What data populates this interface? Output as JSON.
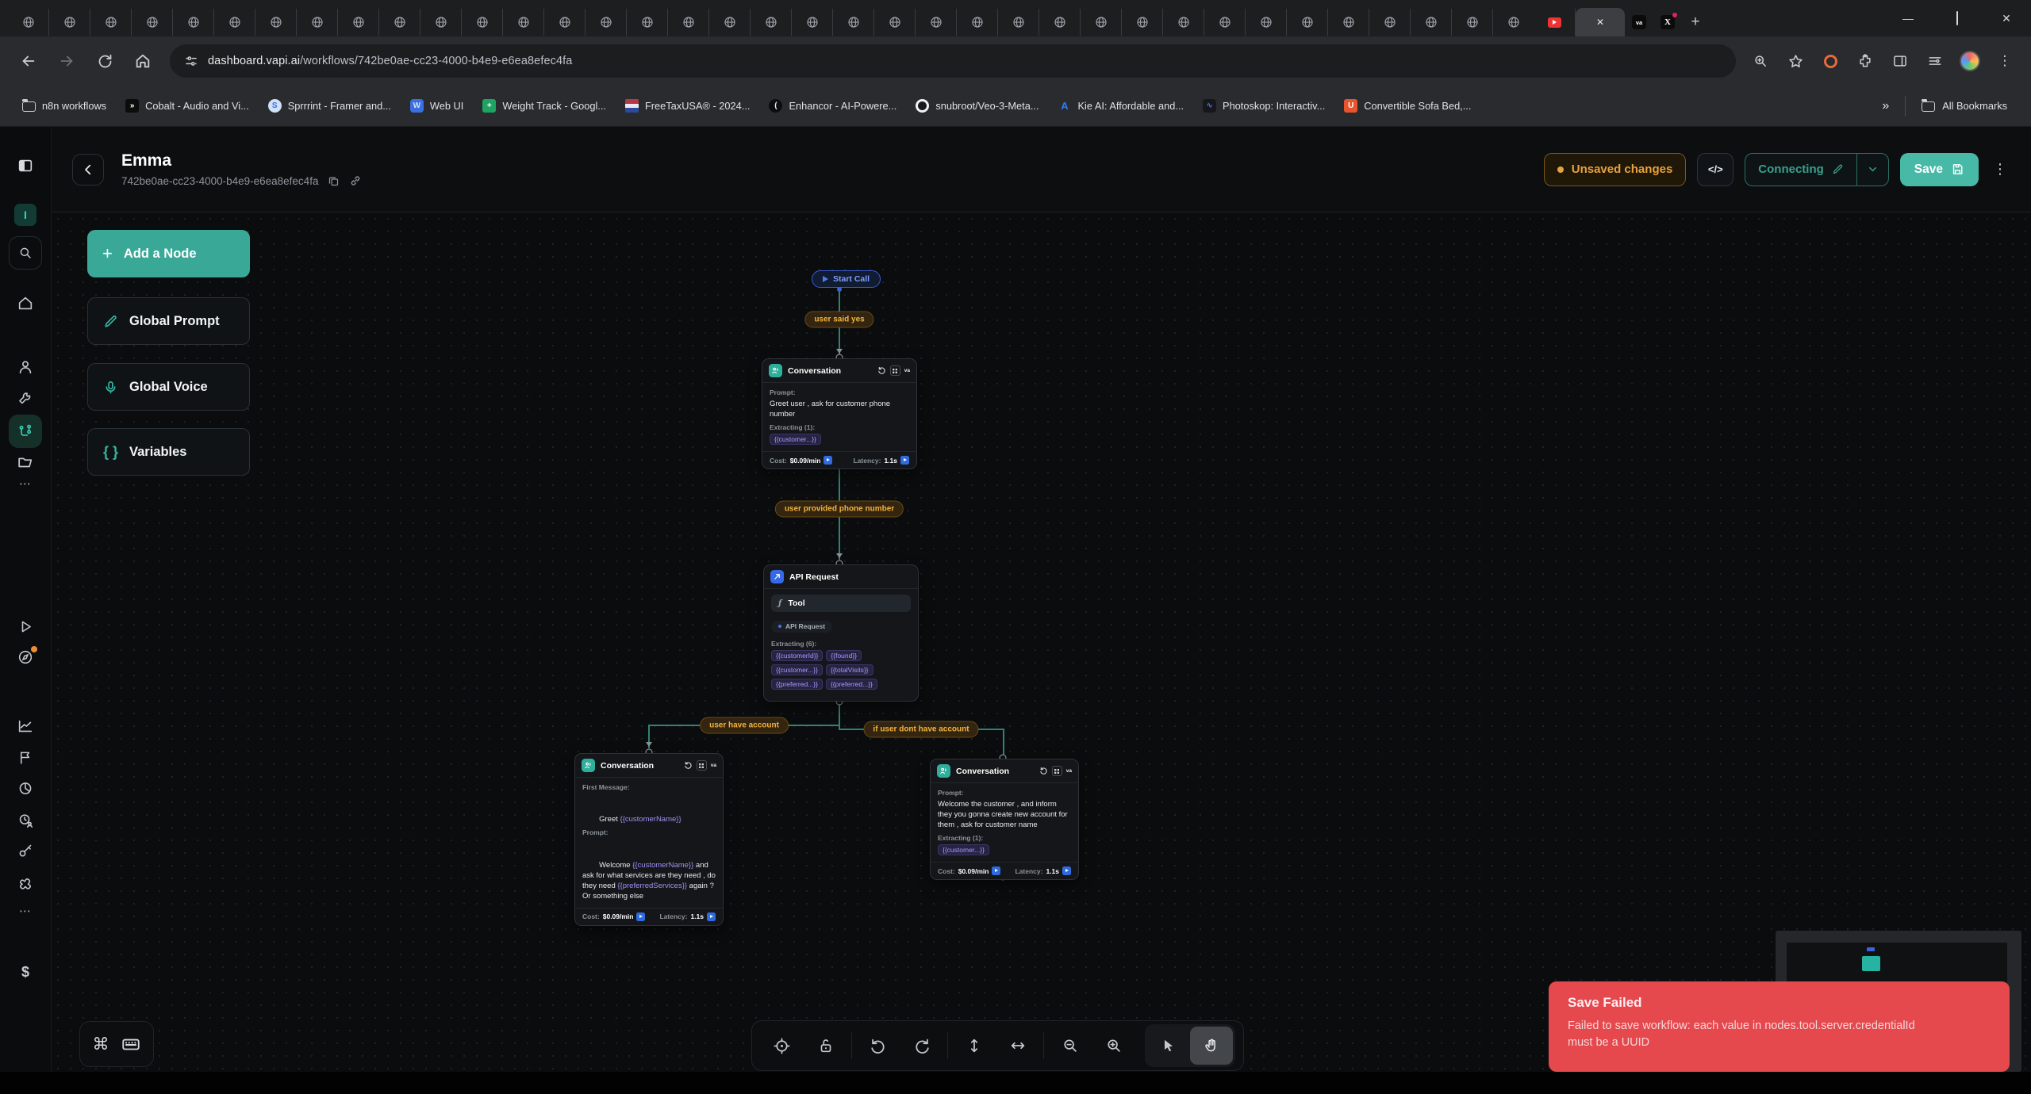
{
  "colors": {
    "accent_teal": "#39a897",
    "save_teal": "#48b9a6",
    "warning_amber": "#e9a33c",
    "error_red": "#e5484d",
    "variable_purple": "#a190f5",
    "edge_teal": "#2e8471",
    "start_blue": "#7e9dfc"
  },
  "browser": {
    "generic_tab_count": 37,
    "active_tab_close": "✕",
    "va_tab_label": "va",
    "x_tab_label": "X",
    "new_tab_glyph": "+",
    "window_controls": {
      "minimize": "—",
      "close": "✕"
    },
    "url_host": "dashboard.vapi.ai",
    "url_path": "/workflows/742be0ae-cc23-4000-b4e9-e6ea8efec4fa",
    "bookmarks": [
      {
        "label": "n8n workflows",
        "icon": "folder"
      },
      {
        "label": "Cobalt - Audio and Vi...",
        "icon": "cobalt",
        "glyph": "»"
      },
      {
        "label": "Sprrrint - Framer and...",
        "icon": "sprrrint",
        "glyph": "S"
      },
      {
        "label": "Web UI",
        "icon": "webui",
        "glyph": "W"
      },
      {
        "label": "Weight Track - Googl...",
        "icon": "sheets",
        "glyph": "+"
      },
      {
        "label": "FreeTaxUSA® - 2024...",
        "icon": "freetax",
        "glyph": ""
      },
      {
        "label": "Enhancor - AI-Powere...",
        "icon": "enhancor",
        "glyph": "("
      },
      {
        "label": "snubroot/Veo-3-Meta...",
        "icon": "github",
        "glyph": ""
      },
      {
        "label": "Kie AI: Affordable and...",
        "icon": "kie",
        "glyph": "A"
      },
      {
        "label": "Photoskop: Interactiv...",
        "icon": "photoskop",
        "glyph": "∿"
      },
      {
        "label": "Convertible Sofa Bed,...",
        "icon": "sofa",
        "glyph": "U"
      }
    ],
    "overflow_glyph": "»",
    "all_bookmarks_label": "All Bookmarks",
    "urlbar_right_icons": [
      "zoom-search-icon",
      "star-icon",
      "extension-alert-icon",
      "puzzle-icon",
      "side-panel-icon",
      "tune-icon",
      "avatar",
      "menu-kebab-icon"
    ]
  },
  "sidebar": {
    "org_initial": "I",
    "billing_glyph": "$",
    "more_glyph": "⋯",
    "icons": [
      "panel-toggle-icon",
      "org-badge",
      "search-icon",
      "home-icon",
      "assistants-icon",
      "tools-icon",
      "workflows-icon",
      "files-icon",
      "more-icon",
      "test-icon",
      "discover-icon",
      "analytics-icon",
      "flags-icon",
      "usage-icon",
      "sessions-icon",
      "keys-icon",
      "integrations-icon",
      "more-icon",
      "billing-icon"
    ]
  },
  "header": {
    "title": "Emma",
    "workflow_id": "742be0ae-cc23-4000-b4e9-e6ea8efec4fa",
    "unsaved_badge": "Unsaved changes",
    "code_button": "</>",
    "connecting_button": "Connecting",
    "save_button": "Save",
    "kebab_glyph": "⋮"
  },
  "panel": {
    "add_node": "Add a Node",
    "add_glyph": "+",
    "global_prompt": "Global Prompt",
    "global_voice": "Global Voice",
    "variables": "Variables",
    "variables_glyph": "{ }"
  },
  "workflow": {
    "start_call_label": "Start Call",
    "edge_labels": {
      "start_to_conv": "user said yes",
      "conv_to_api": "user provided phone number",
      "api_to_left": "user have account",
      "api_to_right": "if user dont have account"
    },
    "conversation_top": {
      "title": "Conversation",
      "prompt_label": "Prompt:",
      "prompt": "Greet user , ask for customer phone number",
      "extracting_label": "Extracting (1):",
      "chips": [
        "{{customer...}}"
      ],
      "cost_label": "Cost:",
      "cost": "$0.09/min",
      "latency_label": "Latency:",
      "latency": "1.1s"
    },
    "api_request": {
      "title": "API Request",
      "fn_glyph": "ƒ",
      "tool_label": "Tool",
      "badge": "API Request",
      "extracting_label": "Extracting (6):",
      "chips": [
        "{{customerId}}",
        "{{found}}",
        "{{customer...}}",
        "{{totalVisits}}",
        "{{preferred...}}",
        "{{preferred...}}"
      ]
    },
    "conversation_left": {
      "title": "Conversation",
      "first_message_label": "First Message:",
      "first_message_segments": [
        {
          "t": "Greet "
        },
        {
          "v": "{{customerName}}"
        }
      ],
      "prompt_label": "Prompt:",
      "prompt_segments": [
        {
          "t": "Welcome "
        },
        {
          "v": "{{customerName}}"
        },
        {
          "t": " and ask for what services are they need , do they need "
        },
        {
          "v": "{{preferredServices}}"
        },
        {
          "t": " again ? Or something else"
        }
      ],
      "cost_label": "Cost:",
      "cost": "$0.09/min",
      "latency_label": "Latency:",
      "latency": "1.1s"
    },
    "conversation_right": {
      "title": "Conversation",
      "prompt_label": "Prompt:",
      "prompt": "Welcome the customer , and inform they you gonna create new account for them , ask for customer name",
      "extracting_label": "Extracting (1):",
      "chips": [
        "{{customer...}}"
      ],
      "cost_label": "Cost:",
      "cost": "$0.09/min",
      "latency_label": "Latency:",
      "latency": "1.1s"
    }
  },
  "toolbar": {
    "icons": [
      "fit-view-icon",
      "unlock-icon",
      "undo-icon",
      "redo-icon",
      "vertical-layout-icon",
      "horizontal-layout-icon",
      "zoom-out-icon",
      "zoom-in-icon",
      "pointer-icon",
      "pan-hand-icon"
    ],
    "active_tool": "pan-hand"
  },
  "shortcuts": {
    "command_glyph": "⌘"
  },
  "toast": {
    "title": "Save Failed",
    "message": "Failed to save workflow: each value in nodes.tool.server.credentialId must be a UUID"
  }
}
